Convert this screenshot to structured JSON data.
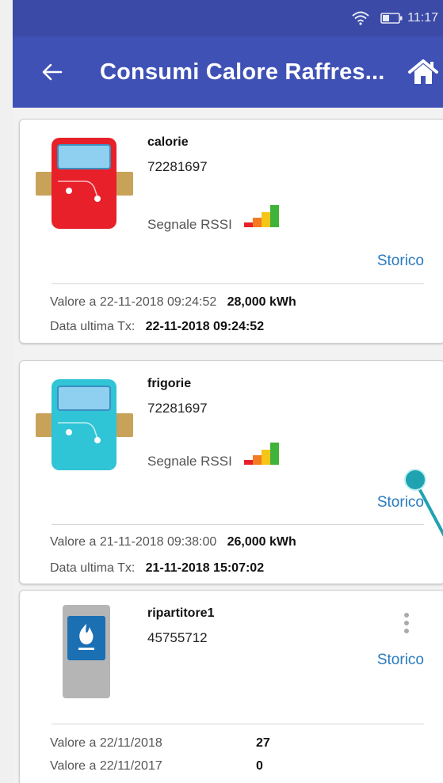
{
  "status_bar": {
    "time": "11:17"
  },
  "app_bar": {
    "title": "Consumi Calore Raffres..."
  },
  "cards": [
    {
      "name": "calorie",
      "serial": "72281697",
      "rssi_label": "Segnale RSSI",
      "storico_label": "Storico",
      "value_label": "Valore a 22-11-2018 09:24:52",
      "value": "28,000 kWh",
      "last_tx_label": "Data ultima Tx:",
      "last_tx": "22-11-2018 09:24:52",
      "meter_color": "#e8202a"
    },
    {
      "name": "frigorie",
      "serial": "72281697",
      "rssi_label": "Segnale RSSI",
      "storico_label": "Storico",
      "value_label": "Valore a 21-11-2018 09:38:00",
      "value": "26,000 kWh",
      "last_tx_label": "Data ultima Tx:",
      "last_tx": "21-11-2018 15:07:02",
      "meter_color": "#2fc4d6"
    },
    {
      "name": "ripartitore1",
      "serial": "45755712",
      "storico_label": "Storico",
      "row1_label": "Valore a 22/11/2018",
      "row1_value": "27",
      "row2_label": "Valore a 22/11/2017",
      "row2_value": "0"
    }
  ],
  "colors": {
    "primary": "#3f51b5",
    "status_bar": "#3a4aa6",
    "link": "#2a7bc0",
    "rssi_bars": [
      "#e8202a",
      "#f47b20",
      "#f5c518",
      "#3fb23a"
    ]
  }
}
